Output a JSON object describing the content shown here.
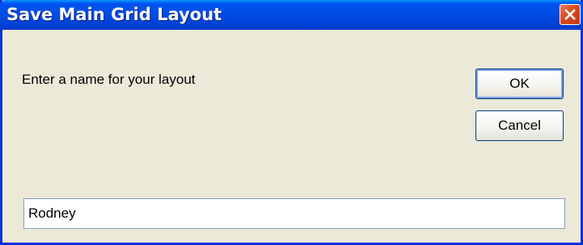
{
  "dialog": {
    "title": "Save Main Grid Layout",
    "prompt": "Enter a name for your layout",
    "ok_label": "OK",
    "cancel_label": "Cancel",
    "close_icon": "close-icon",
    "name_value": "Rodney"
  },
  "colors": {
    "titlebar": "#0053ee",
    "frame": "#0831d9",
    "background": "#ece9d8",
    "close_button": "#d9491f"
  }
}
